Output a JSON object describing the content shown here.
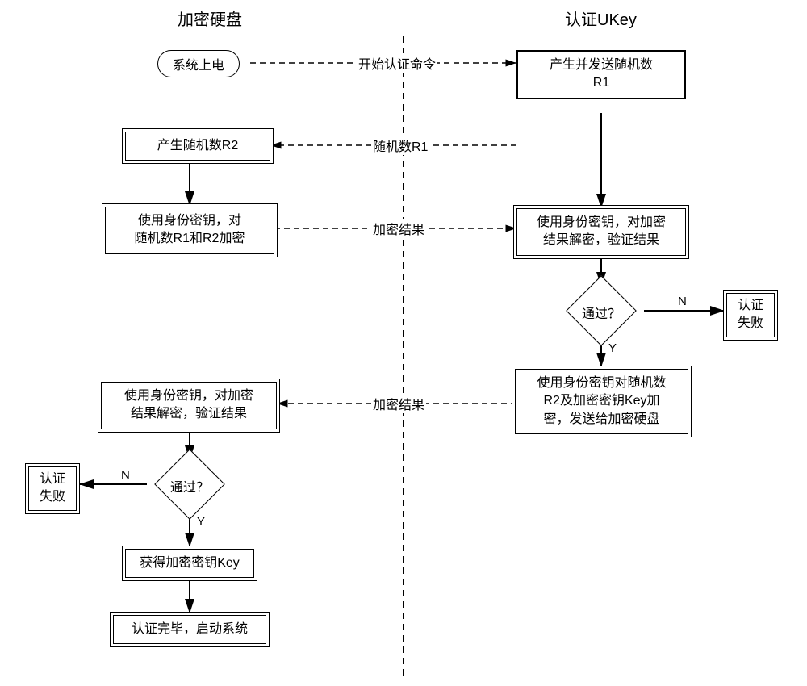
{
  "headers": {
    "left": "加密硬盘",
    "right": "认证UKey"
  },
  "left": {
    "start": "系统上电",
    "genR2": "产生随机数R2",
    "encrypt": "使用身份密钥，对\n随机数R1和R2加密",
    "decrypt": "使用身份密钥，对加密\n结果解密，验证结果",
    "fail": "认证\n失败",
    "getKey": "获得加密密钥Key",
    "done": "认证完毕，启动系统",
    "pass": "通过？"
  },
  "right": {
    "genR1": "产生并发送随机数\nR1",
    "decrypt": "使用身份密钥，对加密\n结果解密，验证结果",
    "encryptKey": "使用身份密钥对随机数\nR2及加密密钥Key加\n密，发送给加密硬盘",
    "fail": "认证\n失败",
    "pass": "通过？"
  },
  "msgs": {
    "startAuth": "开始认证命令",
    "r1": "随机数R1",
    "encResult": "加密结果"
  },
  "yn": {
    "y": "Y",
    "n": "N"
  }
}
